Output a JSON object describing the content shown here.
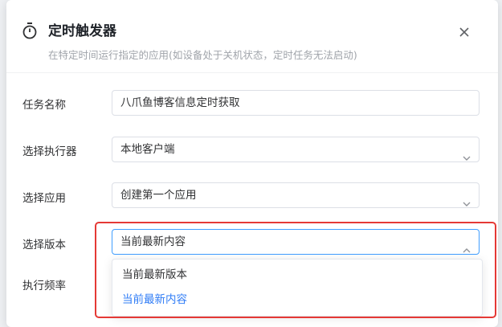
{
  "modal": {
    "title": "定时触发器",
    "subtitle": "在特定时间运行指定的应用(如设备处于关机状态，定时任务无法启动)",
    "icons": {
      "timer": "timer-icon",
      "close": "close-icon",
      "chevron": "chevron-down-icon"
    }
  },
  "form": {
    "task_name": {
      "label": "任务名称",
      "value": "八爪鱼博客信息定时获取"
    },
    "executor": {
      "label": "选择执行器",
      "value": "本地客户端"
    },
    "app": {
      "label": "选择应用",
      "value": "创建第一个应用"
    },
    "version": {
      "label": "选择版本",
      "value": "当前最新内容",
      "options": [
        "当前最新版本",
        "当前最新内容"
      ],
      "selected_index": 1
    },
    "frequency": {
      "label": "执行频率"
    }
  },
  "colors": {
    "accent": "#2f7cf6",
    "highlight": "#e53935"
  }
}
